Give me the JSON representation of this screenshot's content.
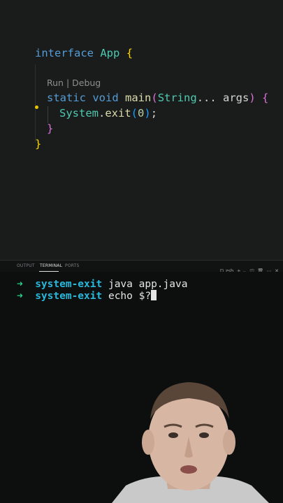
{
  "editor": {
    "line1": {
      "kw": "interface",
      "name": "App",
      "brace": "{"
    },
    "codelens": "Run | Debug",
    "line2": {
      "kw1": "static",
      "kw2": "void",
      "fn": "main",
      "paren_open": "(",
      "type": "String",
      "rest": "... args",
      "paren_close": ")",
      "brace": "{"
    },
    "line3": {
      "obj": "System",
      "dot": ".",
      "fn": "exit",
      "paren_open": "(",
      "num": "0",
      "paren_close": ")",
      "semi": ";"
    },
    "line4": {
      "brace": "}"
    },
    "line5": {
      "brace": "}"
    }
  },
  "panel": {
    "tabs": [
      "OUTPUT",
      "TERMINAL",
      "PORTS"
    ],
    "active_tab": "TERMINAL",
    "shell": "zsh",
    "icons": [
      "terminal-icon",
      "plus-icon",
      "chevron-down-icon",
      "split-icon",
      "trash-icon",
      "more-icon",
      "close-icon"
    ]
  },
  "terminal": {
    "lines": [
      {
        "arrow": "➜",
        "dir": "system-exit",
        "cmd": "java app.java"
      },
      {
        "arrow": "➜",
        "dir": "system-exit",
        "cmd": "echo $?"
      }
    ]
  },
  "colors": {
    "editor_bg": "#1a1c1c",
    "terminal_bg": "#0d0f0f",
    "keyword": "#569cd6",
    "type": "#4ec9b0",
    "function": "#dcdcaa",
    "prompt_arrow": "#23d18b",
    "prompt_dir": "#29b8db"
  }
}
